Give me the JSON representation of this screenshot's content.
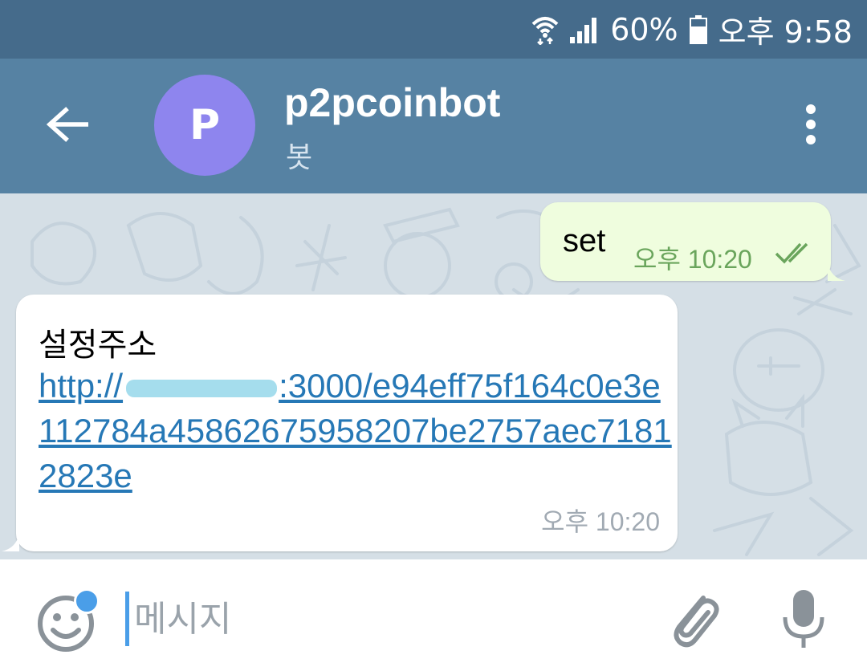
{
  "status_bar": {
    "battery_percent": "60%",
    "time": "오후 9:58"
  },
  "header": {
    "avatar_letter": "P",
    "title": "p2pcoinbot",
    "subtitle": "봇"
  },
  "messages": {
    "outgoing": {
      "text": "set",
      "time": "오후 10:20",
      "read_status_icon": "double-check-icon"
    },
    "incoming": {
      "title": "설정주소",
      "link_prefix": "http://",
      "link_rest": ":3000/e94eff75f164c0e3e112784a45862675958207be2757aec71812823e",
      "time": "오후 10:20"
    }
  },
  "composer": {
    "placeholder": "메시지"
  },
  "colors": {
    "status_bar": "#456b8b",
    "app_bar": "#5682a3",
    "avatar": "#8e85ee",
    "outgoing_bubble": "#effdde",
    "link": "#2678b6",
    "accent": "#4a9ee8"
  }
}
